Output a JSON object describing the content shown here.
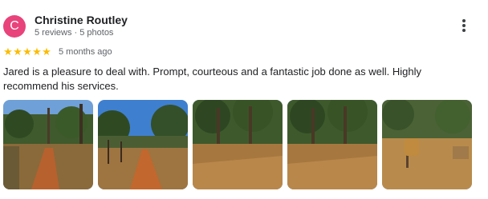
{
  "reviewer": {
    "avatar_initial": "C",
    "avatar_color": "#e8437b",
    "name": "Christine Routley",
    "meta": "5 reviews · 5 photos"
  },
  "rating": {
    "stars": 5,
    "max_stars": 5,
    "star_color": "#fbbc04",
    "time_ago": "5 months ago"
  },
  "review_text": "Jared is a pleasure to deal with. Prompt, courteous and a fantastic job done as well. Highly recommend his services.",
  "photos": [
    {
      "name": "photo-1",
      "scene": "dirt-track-through-bush"
    },
    {
      "name": "photo-2",
      "scene": "dirt-track-with-fence"
    },
    {
      "name": "photo-3",
      "scene": "cleared-ground-with-trees"
    },
    {
      "name": "photo-4",
      "scene": "cleared-ground-with-trees"
    },
    {
      "name": "photo-5",
      "scene": "cleared-ground-with-log"
    }
  ]
}
